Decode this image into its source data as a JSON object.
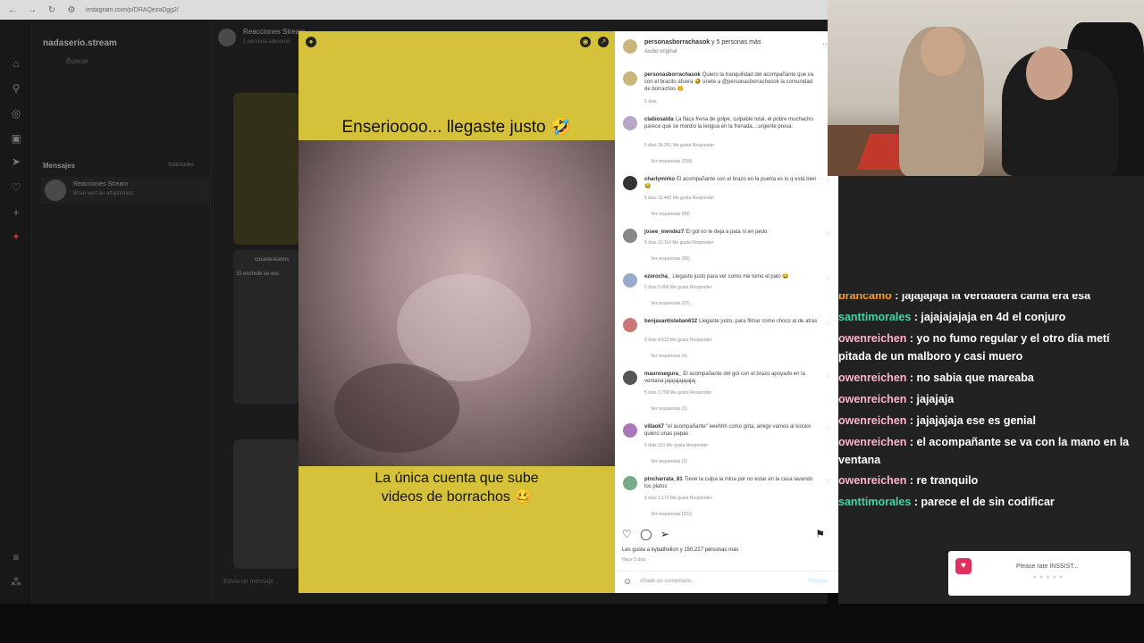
{
  "browser": {
    "url": "instagram.com/p/DRAQezaDgg2/",
    "account": "nadaserio.stream",
    "search_placeholder": "Buscar",
    "mensajes": "Mensajes",
    "solicitudes": "Solicitudes",
    "thread_name": "Reacciones Stream",
    "thread_sub": "Brian sent an attachment.",
    "chat_head": "Reacciones Stream",
    "chat_headsub": "1 persona adicional",
    "chat_input": "Envía un mensaje...",
    "thumb_label": "cosadeskaters",
    "thumb_text": "El enchufe se esc"
  },
  "post": {
    "top_text": "Enserioooo... llegaste justo 🤣",
    "bottom_text_1": "La única cuenta que sube",
    "bottom_text_2": "videos de borrachos 🥴",
    "owner": "personasborrachasok",
    "owner_suffix": " y 5 personas más",
    "audio": "Audio original",
    "caption_user": "personasborrachasok",
    "caption_text": "Quiero la tranquilidad del acompañante que va con el bracito afuera 🤣 únete a @personasborrachosok la comunidad de borrachos 🥴",
    "caption_meta": "5 días",
    "comments": [
      {
        "user": "clabiosalda",
        "text": "La flaca frena de golpe, culpable total, el pobre muchacho parece que se mordio la lengua en la frenada....urgente presa.",
        "meta": "5 días   38.261 Me gusta   Responder",
        "replies": "Ver respuestas (234)"
      },
      {
        "user": "charlymirko",
        "text": "El acompañante con el brazo en la puerta es lo q está bien 😂",
        "meta": "5 días   15.442 Me gusta   Responder",
        "replies": "Ver respuestas (58)"
      },
      {
        "user": "josee_mendez7",
        "text": "El gol no te deja a pata ni en pedo",
        "meta": "5 días   10.114 Me gusta   Responder",
        "replies": "Ver respuestas (58)"
      },
      {
        "user": "ezerocha_",
        "text": "Llegaste justo para ver como me tomo el palo 😂",
        "meta": "5 días   5.086 Me gusta   Responder",
        "replies": "Ver respuestas (22)"
      },
      {
        "user": "benjasantisteban632",
        "text": "Llegaste justo, para filmar como choco al de atrás",
        "meta": "5 días   4.623 Me gusta   Responder",
        "replies": "Ver respuestas (4)"
      },
      {
        "user": "maurosegura_",
        "text": "El acompañante del gol con el brazo apoyado en la ventana jajajajajajajaj",
        "meta": "5 días   3.768 Me gusta   Responder",
        "replies": "Ver respuestas (3)"
      },
      {
        "user": "villaok7",
        "text": "\"el acompañante\" eeehhh como grita, amigo vamos al kiosko quiero unas papas",
        "meta": "5 días   331 Me gusta   Responder",
        "replies": "Ver respuestas (2)"
      },
      {
        "user": "pincharrata_81",
        "text": "Tiene la culpa la mina por no estar en la casa lavando los platos",
        "meta": "5 días   3.172 Me gusta   Responder",
        "replies": "Ver respuestas (322)"
      }
    ],
    "likes": "Les gusta a kybathelion y 150.227 personas más",
    "ago": "Hace 5 días",
    "comment_placeholder": "Añade un comentario...",
    "publish": "Publicar"
  },
  "chat": [
    {
      "user": "brancamo",
      "text": " : jajajajaja la verdadera cama era esa",
      "color": "#ff9d2e"
    },
    {
      "user": "santtimorales",
      "text": " : jajajajajaja en 4d el conjuro",
      "color": "#3fd6a8"
    },
    {
      "user": "owenreichen",
      "text": " : yo no fumo regular y el otro dia metí pitada de un malboro y casi muero",
      "color": "#ffb3d1"
    },
    {
      "user": "owenreichen",
      "text": " : no sabia que mareaba",
      "color": "#ffb3d1"
    },
    {
      "user": "owenreichen",
      "text": " : jajajaja",
      "color": "#ffb3d1"
    },
    {
      "user": "owenreichen",
      "text": " : jajajajaja ese es genial",
      "color": "#ffb3d1"
    },
    {
      "user": "owenreichen",
      "text": " : el acompañante se va con la mano en la ventana",
      "color": "#ffb3d1"
    },
    {
      "user": "owenreichen",
      "text": " : re tranquilo",
      "color": "#ffb3d1"
    },
    {
      "user": "santtimorales",
      "text": " : parece el de sin codificar",
      "color": "#3fd6a8"
    }
  ],
  "rate": {
    "text": "Please rate INSSIST..."
  }
}
